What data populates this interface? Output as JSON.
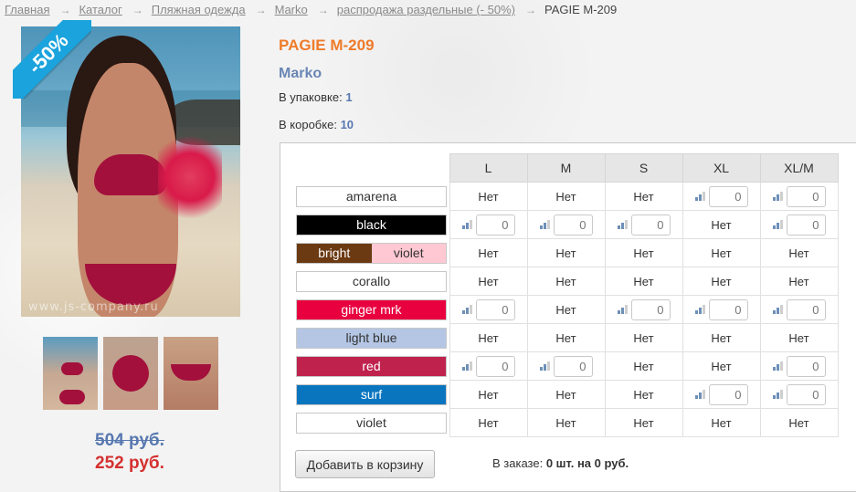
{
  "breadcrumb": {
    "items": [
      "Главная",
      "Каталог",
      "Пляжная одежда",
      "Marko",
      "распродажа раздельные (- 50%)"
    ],
    "separator": "→",
    "current": "PAGIE M-209"
  },
  "product": {
    "sale_badge": "-50%",
    "watermark": "www.js-company.ru",
    "title": "PAGIE M-209",
    "brand": "Marko",
    "pack_label": "В упаковке:",
    "pack_value": "1",
    "box_label": "В коробке:",
    "box_value": "10",
    "price_old": "504 руб.",
    "price_new": "252 руб."
  },
  "grid": {
    "sizes": [
      "L",
      "M",
      "S",
      "XL",
      "XL/M"
    ],
    "unavailable": "Нет",
    "default_qty": "0",
    "rows": [
      {
        "color": "amarena",
        "bg": "#ffffff",
        "fg": "#333333",
        "avail": [
          false,
          false,
          false,
          true,
          true
        ]
      },
      {
        "color": "black",
        "bg": "#000000",
        "fg": "#ffffff",
        "avail": [
          true,
          true,
          true,
          false,
          true
        ]
      },
      {
        "color": "bright",
        "color2": "violet",
        "bg": "#6b3a12",
        "fg": "#ffffff",
        "bg2": "#ffc8d2",
        "fg2": "#333333",
        "avail": [
          false,
          false,
          false,
          false,
          false
        ]
      },
      {
        "color": "corallo",
        "bg": "#ffffff",
        "fg": "#333333",
        "avail": [
          false,
          false,
          false,
          false,
          false
        ]
      },
      {
        "color": "ginger mrk",
        "bg": "#e8003f",
        "fg": "#ffffff",
        "avail": [
          true,
          false,
          true,
          true,
          true
        ]
      },
      {
        "color": "light blue",
        "bg": "#b4c6e4",
        "fg": "#333333",
        "avail": [
          false,
          false,
          false,
          false,
          false
        ]
      },
      {
        "color": "red",
        "bg": "#c0224e",
        "fg": "#ffffff",
        "avail": [
          true,
          true,
          false,
          false,
          true
        ]
      },
      {
        "color": "surf",
        "bg": "#0a75bf",
        "fg": "#ffffff",
        "avail": [
          false,
          false,
          false,
          true,
          true
        ]
      },
      {
        "color": "violet",
        "bg": "#ffffff",
        "fg": "#333333",
        "avail": [
          false,
          false,
          false,
          false,
          false
        ]
      }
    ]
  },
  "cart": {
    "add_button": "Добавить в корзину",
    "order_label": "В заказе:",
    "order_qty": "0 шт.",
    "order_mid": "на",
    "order_sum": "0 руб."
  },
  "colors": {
    "title": "#ef7b2a",
    "brand": "#6a86b4",
    "price_old": "#5878b0",
    "price_new": "#d4302f",
    "sale_badge": "#1aa3dd"
  }
}
